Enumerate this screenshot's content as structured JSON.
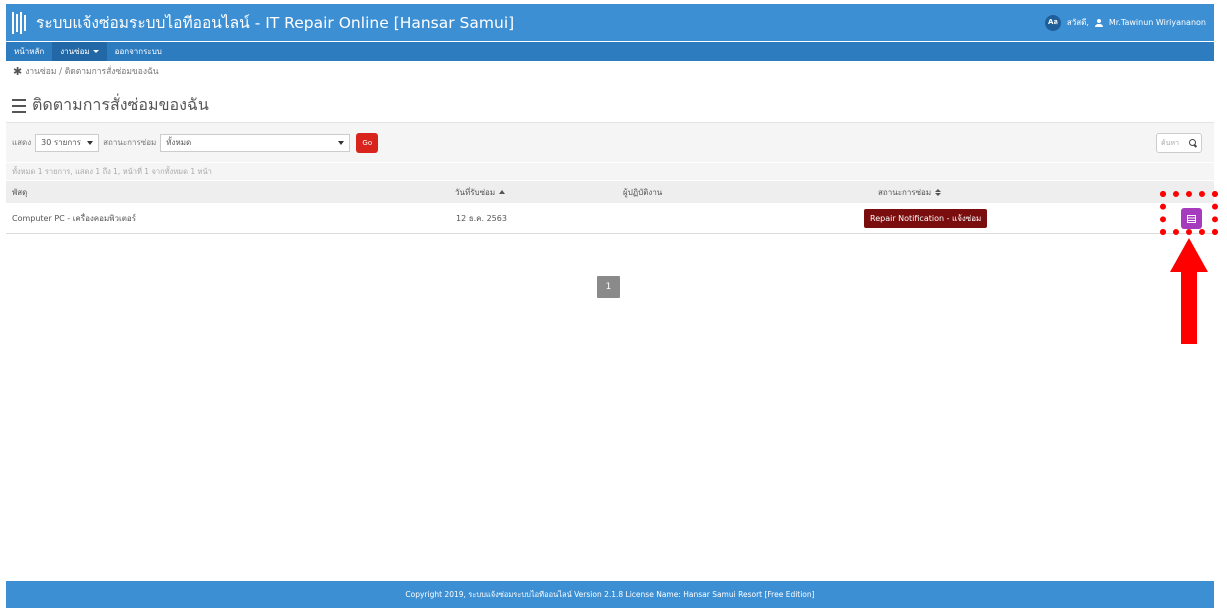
{
  "header": {
    "title": "ระบบแจ้งซ่อมระบบไอทีออนไลน์ - IT Repair Online [Hansar Samui]",
    "lang_badge": "Aล",
    "greeting": "สวัสดี,",
    "user_name": "Mr.Tawinun Wiriyananon"
  },
  "nav": {
    "items": [
      {
        "label": "หน้าหลัก"
      },
      {
        "label": "งานซ่อม"
      },
      {
        "label": "ออกจากระบบ"
      }
    ]
  },
  "breadcrumb": {
    "text": "งานซ่อม / ติดตามการสั่งซ่อมของฉัน"
  },
  "page": {
    "title": "ติดตามการสั่งซ่อมของฉัน"
  },
  "filters": {
    "show_label": "แสดง",
    "page_size": "30 รายการ",
    "status_label": "สถานะการซ่อม",
    "status_value": "ทั้งหมด",
    "go_label": "Go",
    "search_placeholder": "ค้นหา"
  },
  "summary": {
    "text": "ทั้งหมด 1 รายการ, แสดง 1 ถึง 1, หน้าที่ 1 จากทั้งหมด 1 หน้า"
  },
  "table": {
    "columns": [
      "พัสดุ",
      "วันที่รับซ่อม",
      "ผู้ปฏิบัติงาน",
      "สถานะการซ่อม"
    ],
    "rows": [
      {
        "item": "Computer PC - เครื่องคอมพิวเตอร์",
        "date": "12 ธ.ค. 2563",
        "operator": "",
        "status": "Repair Notification - แจ้งซ่อม"
      }
    ]
  },
  "pagination": {
    "current": "1"
  },
  "footer": {
    "text": "Copyright 2019, ระบบแจ้งซ่อมระบบไอทีออนไลน์ Version 2.1.8 License Name: Hansar Samui Resort [Free Edition]"
  },
  "colors": {
    "header_bg": "#3d8fd4",
    "status_badge": "#7a0d0d",
    "view_button": "#a53bbd",
    "go_button": "#d9231d",
    "annotation": "#ff0000"
  },
  "icons": {
    "logo": "bars-logo-icon",
    "user": "user-icon",
    "breadcrumb": "star-icon",
    "title": "checklist-icon",
    "search": "search-icon",
    "view": "list-view-icon",
    "arrow": "up-arrow-icon"
  }
}
